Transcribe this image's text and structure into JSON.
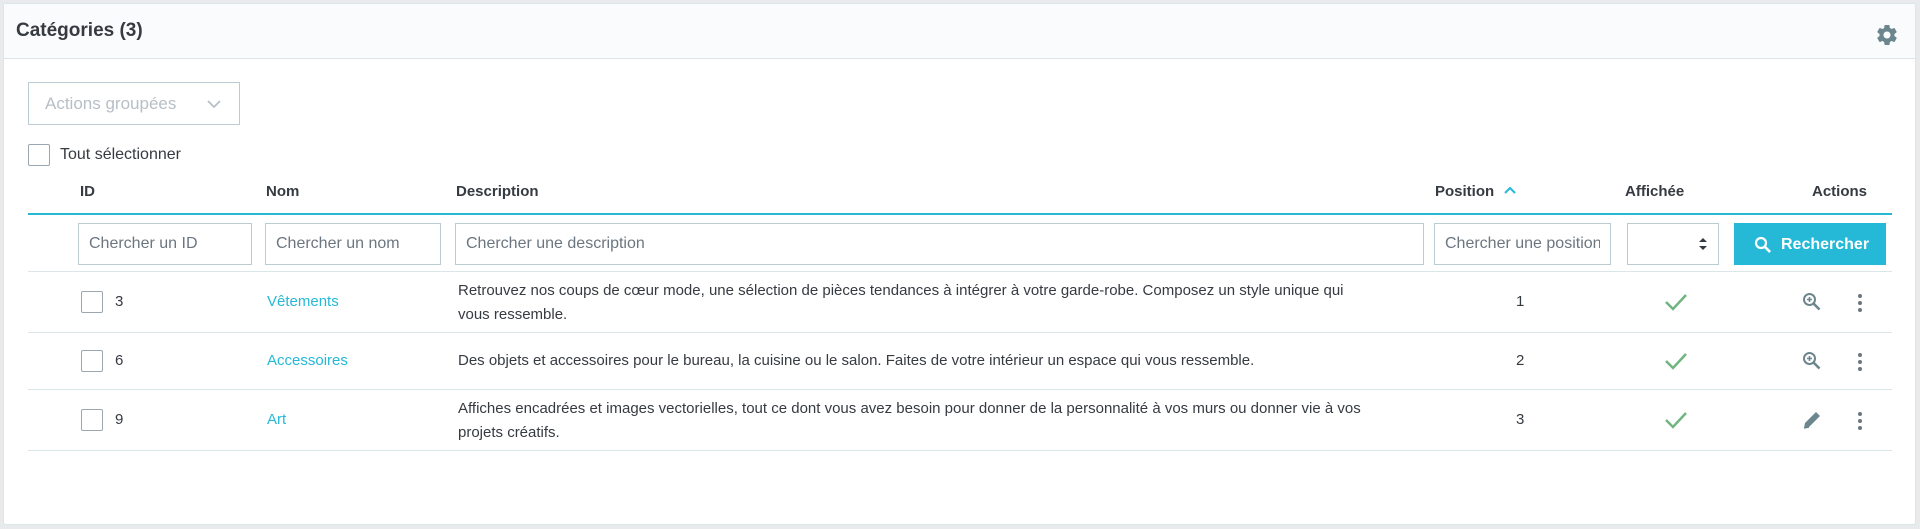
{
  "header": {
    "title": "Catégories (3)",
    "settings_icon": "gear-icon"
  },
  "toolbar": {
    "bulk_actions_label": "Actions groupées",
    "select_all_label": "Tout sélectionner"
  },
  "table": {
    "columns": {
      "id": "ID",
      "name": "Nom",
      "description": "Description",
      "position": "Position",
      "displayed": "Affichée",
      "actions": "Actions"
    },
    "sort": {
      "column": "position",
      "direction": "asc"
    },
    "filters": {
      "id_placeholder": "Chercher un ID",
      "name_placeholder": "Chercher un nom",
      "description_placeholder": "Chercher une description",
      "position_placeholder": "Chercher une position",
      "displayed_value": "",
      "search_label": "Rechercher"
    },
    "rows": [
      {
        "id": "3",
        "name": "Vêtements",
        "description_line1": "Retrouvez nos coups de cœur mode, une sélection de pièces tendances à intégrer à votre garde-robe. Composez un style unique qui",
        "description_line2": "vous ressemble.",
        "position": "1",
        "displayed": true,
        "action_icon": "zoom-in-icon"
      },
      {
        "id": "6",
        "name": "Accessoires",
        "description_line1": "Des objets et accessoires pour le bureau, la cuisine ou le salon. Faites de votre intérieur un espace qui vous ressemble.",
        "description_line2": "",
        "position": "2",
        "displayed": true,
        "action_icon": "zoom-in-icon"
      },
      {
        "id": "9",
        "name": "Art",
        "description_line1": "Affiches encadrées et images vectorielles, tout ce dont vous avez besoin pour donner de la personnalité à vos murs ou donner vie à vos",
        "description_line2": "projets créatifs.",
        "position": "3",
        "displayed": true,
        "action_icon": "pencil-icon"
      }
    ]
  },
  "colors": {
    "accent": "#25b9d7",
    "check": "#70b580",
    "text": "#363a41",
    "border": "#bbcdd2"
  }
}
